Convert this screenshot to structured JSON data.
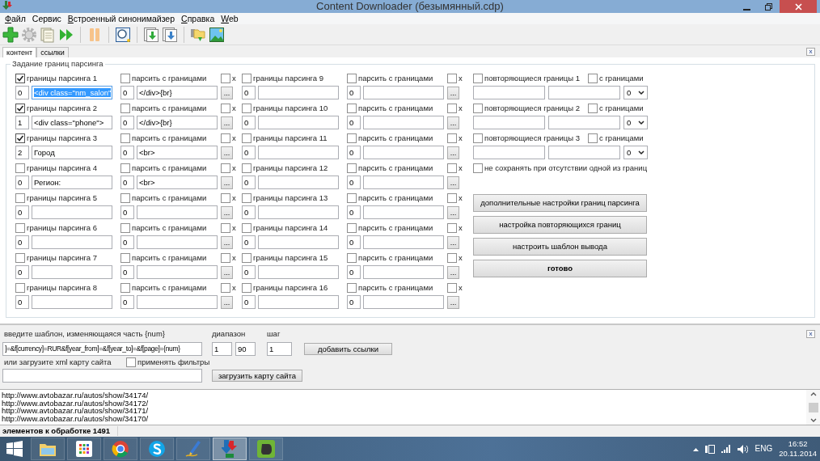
{
  "window": {
    "title": "Content Downloader (безымянный.cdp)"
  },
  "menu": [
    {
      "label": "Файл",
      "underline_first": true
    },
    {
      "label": "Сервис",
      "underline_first": false
    },
    {
      "label": "Встроенный синонимайзер",
      "underline_first": true
    },
    {
      "label": "Справка",
      "underline_first": true
    },
    {
      "label": "Web",
      "underline_first": true
    }
  ],
  "tabs": [
    {
      "label": "контент",
      "selected": true
    },
    {
      "label": "ссылки",
      "selected": false
    }
  ],
  "tab_close": "x",
  "group_title": "Задание границ парсинга",
  "bounds": [
    {
      "label": "границы парсинга 1",
      "checked": true,
      "start_index": "0",
      "start": "<div class=\"nm_salon\"",
      "start_selected": true,
      "parse_label": "парсить с границами",
      "parse_checked": false,
      "end_index": "0",
      "end": "</div>{br}",
      "x_label": "x",
      "x_checked": false,
      "more": "..."
    },
    {
      "label": "границы парсинга 2",
      "checked": true,
      "start_index": "1",
      "start": "<div class=\"phone\">",
      "start_selected": false,
      "parse_label": "парсить с границами",
      "parse_checked": false,
      "end_index": "0",
      "end": "</div>{br}",
      "x_label": "x",
      "x_checked": false,
      "more": "..."
    },
    {
      "label": "границы парсинга 3",
      "checked": true,
      "start_index": "2",
      "start": "Город",
      "start_selected": false,
      "parse_label": "парсить с границами",
      "parse_checked": false,
      "end_index": "0",
      "end": "<br>",
      "x_label": "x",
      "x_checked": false,
      "more": "..."
    },
    {
      "label": "границы парсинга 4",
      "checked": false,
      "start_index": "0",
      "start": "Регион:",
      "start_selected": false,
      "parse_label": "парсить с границами",
      "parse_checked": false,
      "end_index": "0",
      "end": "<br>",
      "x_label": "x",
      "x_checked": false,
      "more": "..."
    },
    {
      "label": "границы парсинга 5",
      "checked": false,
      "start_index": "0",
      "start_selected": false,
      "parse_label": "парсить с границами",
      "parse_checked": false,
      "end_index": "0",
      "x_label": "x",
      "x_checked": false,
      "more": "..."
    },
    {
      "label": "границы парсинга 6",
      "checked": false,
      "start_index": "0",
      "start_selected": false,
      "parse_label": "парсить с границами",
      "parse_checked": false,
      "end_index": "0",
      "x_label": "x",
      "x_checked": false,
      "more": "..."
    },
    {
      "label": "границы парсинга 7",
      "checked": false,
      "start_index": "0",
      "start_selected": false,
      "parse_label": "парсить с границами",
      "parse_checked": false,
      "end_index": "0",
      "x_label": "x",
      "x_checked": false,
      "more": "..."
    },
    {
      "label": "границы парсинга 8",
      "checked": false,
      "start_index": "0",
      "start_selected": false,
      "parse_label": "парсить с границами",
      "parse_checked": false,
      "end_index": "0",
      "x_label": "x",
      "x_checked": false,
      "more": "..."
    },
    {
      "label": "границы парсинга 9",
      "checked": false,
      "start_index": "0",
      "start_selected": false,
      "parse_label": "парсить с границами",
      "parse_checked": false,
      "end_index": "0",
      "x_label": "x",
      "x_checked": false,
      "more": "..."
    },
    {
      "label": "границы парсинга 10",
      "checked": false,
      "start_index": "0",
      "start_selected": false,
      "parse_label": "парсить с границами",
      "parse_checked": false,
      "end_index": "0",
      "x_label": "x",
      "x_checked": false,
      "more": "..."
    },
    {
      "label": "границы парсинга 11",
      "checked": false,
      "start_index": "0",
      "start_selected": false,
      "parse_label": "парсить с границами",
      "parse_checked": false,
      "end_index": "0",
      "x_label": "x",
      "x_checked": false,
      "more": "..."
    },
    {
      "label": "границы парсинга 12",
      "checked": false,
      "start_index": "0",
      "start_selected": false,
      "parse_label": "парсить с границами",
      "parse_checked": false,
      "end_index": "0",
      "x_label": "x",
      "x_checked": false,
      "more": "..."
    },
    {
      "label": "границы парсинга 13",
      "checked": false,
      "start_index": "0",
      "start_selected": false,
      "parse_label": "парсить с границами",
      "parse_checked": false,
      "end_index": "0",
      "x_label": "x",
      "x_checked": false,
      "more": "..."
    },
    {
      "label": "границы парсинга 14",
      "checked": false,
      "start_index": "0",
      "start_selected": false,
      "parse_label": "парсить с границами",
      "parse_checked": false,
      "end_index": "0",
      "x_label": "x",
      "x_checked": false,
      "more": "..."
    },
    {
      "label": "границы парсинга 15",
      "checked": false,
      "start_index": "0",
      "start_selected": false,
      "parse_label": "парсить с границами",
      "parse_checked": false,
      "end_index": "0",
      "x_label": "x",
      "x_checked": false,
      "more": "..."
    },
    {
      "label": "границы парсинга 16",
      "checked": false,
      "start_index": "0",
      "start_selected": false,
      "parse_label": "парсить с границами",
      "parse_checked": false,
      "end_index": "0",
      "x_label": "x",
      "x_checked": false,
      "more": "..."
    }
  ],
  "repeat_bounds": [
    {
      "label": "повторяющиеся границы 1",
      "checked": false,
      "bounds_label": "с границами",
      "bounds_checked": false,
      "value": "0"
    },
    {
      "label": "повторяющиеся границы 2",
      "checked": false,
      "bounds_label": "с границами",
      "bounds_checked": false,
      "value": "0"
    },
    {
      "label": "повторяющиеся границы 3",
      "checked": false,
      "bounds_label": "с границами",
      "bounds_checked": false,
      "value": "0"
    }
  ],
  "no_save": {
    "label": "не сохранять при отсутствии одной из границ",
    "checked": false
  },
  "buttons": [
    {
      "label": "дополнительные настройки границ парсинга",
      "bold": false
    },
    {
      "label": "настройка повторяющихся границ",
      "bold": false
    },
    {
      "label": "настроить шаблон вывода",
      "bold": false
    },
    {
      "label": "готово",
      "bold": true
    }
  ],
  "links_panel": {
    "close": "x",
    "template_label": "введите шаблон, изменяющаяся часть {num}",
    "template_value": "]=&f[currency]=RUR&f[year_from]=&f[year_to]=&f[page]={num}",
    "range_label": "диапазон",
    "range_from": "1",
    "range_to": "90",
    "step_label": "шаг",
    "step": "1",
    "add_button": "добавить ссылки",
    "sitemap_label": "или загрузите xml карту сайта",
    "filters": {
      "label": "применять фильтры",
      "checked": false
    },
    "load_button": "загрузить карту сайта"
  },
  "url_list": [
    "http://www.avtobazar.ru/autos/show/34174/",
    "http://www.avtobazar.ru/autos/show/34172/",
    "http://www.avtobazar.ru/autos/show/34171/",
    "http://www.avtobazar.ru/autos/show/34170/"
  ],
  "status_bar": "элементов к обработке 1491",
  "taskbar": [
    {
      "kind": "folder",
      "selected": false
    },
    {
      "kind": "apps",
      "selected": false
    },
    {
      "kind": "browser",
      "selected": false
    },
    {
      "kind": "chat",
      "selected": false
    },
    {
      "kind": "pen",
      "selected": false
    },
    {
      "kind": "download",
      "selected": true
    },
    {
      "kind": "notes",
      "selected": false
    }
  ],
  "tray": {
    "language": "ENG",
    "time": "16:52",
    "date": "20.11.2014"
  }
}
